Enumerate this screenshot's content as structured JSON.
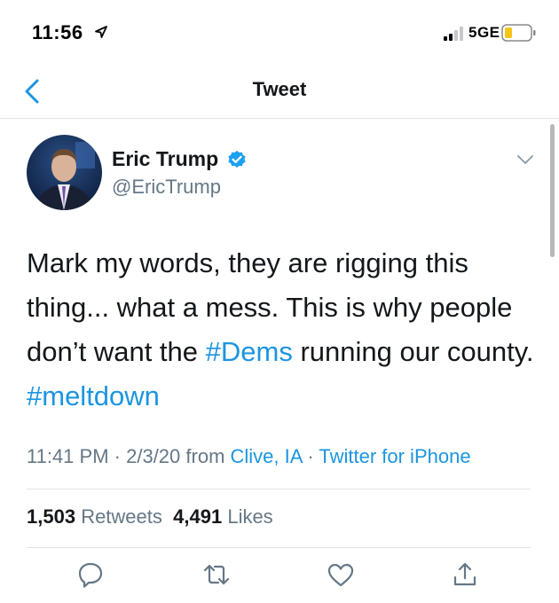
{
  "status_bar": {
    "time": "11:56",
    "network": "5GE",
    "icons": [
      "location-arrow-icon",
      "signal-icon",
      "battery-icon"
    ]
  },
  "nav": {
    "title": "Tweet",
    "back_icon": "chevron-left-icon"
  },
  "tweet": {
    "author": {
      "display_name": "Eric Trump",
      "handle": "@EricTrump",
      "verified": true
    },
    "text_parts": [
      {
        "text": "Mark my words, they are rigging this thing... what a mess. This is why people don’t want the ",
        "type": "text"
      },
      {
        "text": "#Dems",
        "type": "hashtag"
      },
      {
        "text": " running our county. ",
        "type": "text"
      },
      {
        "text": "#meltdown",
        "type": "hashtag"
      }
    ],
    "meta": {
      "time": "11:41 PM",
      "sep1": " · ",
      "date": "2/3/20",
      "from_label": " from ",
      "location": "Clive, IA",
      "sep2": " · ",
      "source": "Twitter for iPhone"
    },
    "stats": {
      "retweets_count": "1,503",
      "retweets_label": "Retweets",
      "likes_count": "4,491",
      "likes_label": "Likes"
    }
  },
  "actions": [
    "reply-icon",
    "retweet-icon",
    "like-icon",
    "share-icon"
  ],
  "colors": {
    "link": "#1b95e0",
    "secondary_text": "#657786",
    "primary_text": "#14171a",
    "divider": "#dfe3e6",
    "icon_gray": "#657786"
  }
}
